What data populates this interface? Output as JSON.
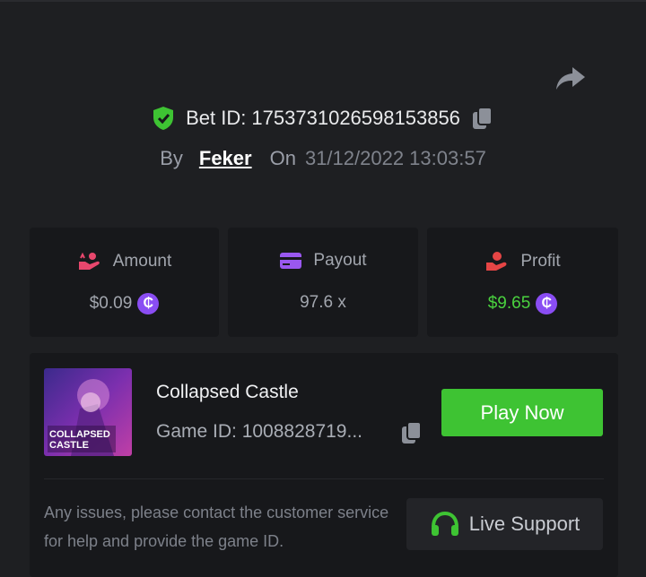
{
  "bet": {
    "label": "Bet ID: 1753731026598153856",
    "by_label": "By",
    "user": "Feker",
    "on_label": "On",
    "datetime": "31/12/2022 13:03:57"
  },
  "stats": [
    {
      "label": "Amount",
      "value": "$0.09",
      "value_color": "#a2a6ae",
      "icon": "hand-coins-icon",
      "icon_color": "#e8476d",
      "has_coin": true
    },
    {
      "label": "Payout",
      "value": "97.6 x",
      "value_color": "#a2a6ae",
      "icon": "credit-card-icon",
      "icon_color": "#9a58f0",
      "has_coin": false
    },
    {
      "label": "Profit",
      "value": "$9.65",
      "value_color": "#4ad23f",
      "icon": "profit-hand-icon",
      "icon_color": "#e64545",
      "has_coin": true
    }
  ],
  "coin_symbol": "₵",
  "game": {
    "name": "Collapsed Castle",
    "id_label": "Game ID: 1008828719...",
    "thumbnail_text_line1": "COLLAPSED",
    "thumbnail_text_line2": "CASTLE",
    "play_label": "Play Now"
  },
  "support": {
    "message": "Any issues, please contact the customer service for help and provide the game ID.",
    "button_label": "Live Support"
  },
  "colors": {
    "accent_green": "#3ec333",
    "background": "#1e1f22",
    "card": "#17181b",
    "coin": "#8a4df3"
  }
}
